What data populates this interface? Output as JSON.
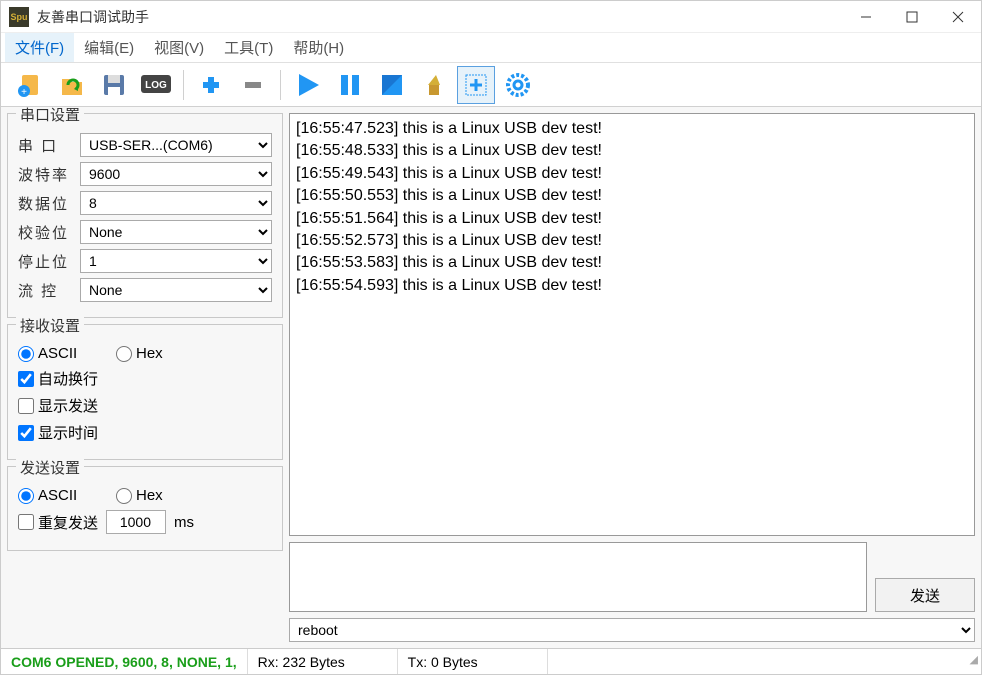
{
  "window": {
    "title": "友善串口调试助手"
  },
  "menu": {
    "file": "文件(F)",
    "edit": "编辑(E)",
    "view": "视图(V)",
    "tools": "工具(T)",
    "help": "帮助(H)"
  },
  "icons": {
    "new": "new",
    "open": "open",
    "save": "save",
    "log": "LOG",
    "plus": "+",
    "minus": "−",
    "play": "play",
    "pause": "pause",
    "stop": "stop",
    "clear": "clear",
    "add": "add",
    "settings": "settings"
  },
  "serial": {
    "legend": "串口设置",
    "port_label": "串  口",
    "port_value": "USB-SER...(COM6)",
    "baud_label": "波特率",
    "baud_value": "9600",
    "data_label": "数据位",
    "data_value": "8",
    "parity_label": "校验位",
    "parity_value": "None",
    "stop_label": "停止位",
    "stop_value": "1",
    "flow_label": "流  控",
    "flow_value": "None"
  },
  "recv": {
    "legend": "接收设置",
    "ascii": "ASCII",
    "hex": "Hex",
    "wrap": "自动换行",
    "show_send": "显示发送",
    "show_time": "显示时间"
  },
  "send": {
    "legend": "发送设置",
    "ascii": "ASCII",
    "hex": "Hex",
    "repeat": "重复发送",
    "interval": "1000",
    "ms": "ms",
    "button": "发送",
    "cmd_value": "reboot"
  },
  "log_lines": [
    "[16:55:47.523] this is a Linux USB dev test!",
    "[16:55:48.533] this is a Linux USB dev test!",
    "[16:55:49.543] this is a Linux USB dev test!",
    "[16:55:50.553] this is a Linux USB dev test!",
    "[16:55:51.564] this is a Linux USB dev test!",
    "[16:55:52.573] this is a Linux USB dev test!",
    "[16:55:53.583] this is a Linux USB dev test!",
    "[16:55:54.593] this is a Linux USB dev test!"
  ],
  "status": {
    "conn": "COM6 OPENED, 9600, 8, NONE, 1,",
    "rx": "Rx: 232 Bytes",
    "tx": "Tx: 0 Bytes"
  }
}
